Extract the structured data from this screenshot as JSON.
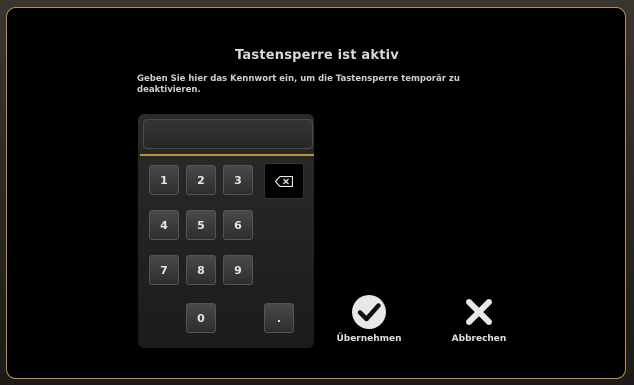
{
  "dialog": {
    "title": "Tastensperre ist aktiv",
    "description": "Geben Sie hier das Kennwort ein, um die Tastensperre temporär zu deaktivieren."
  },
  "keypad": {
    "pin_value": "",
    "keys": {
      "k1": "1",
      "k2": "2",
      "k3": "3",
      "k4": "4",
      "k5": "5",
      "k6": "6",
      "k7": "7",
      "k8": "8",
      "k9": "9",
      "k0": "0",
      "dot": "."
    },
    "backspace_icon": "backspace-icon"
  },
  "actions": {
    "confirm_label": "Übernehmen",
    "confirm_icon": "checkmark-icon",
    "cancel_label": "Abbrechen",
    "cancel_icon": "close-icon"
  },
  "colors": {
    "accent": "#b9913a",
    "background": "#000000"
  }
}
